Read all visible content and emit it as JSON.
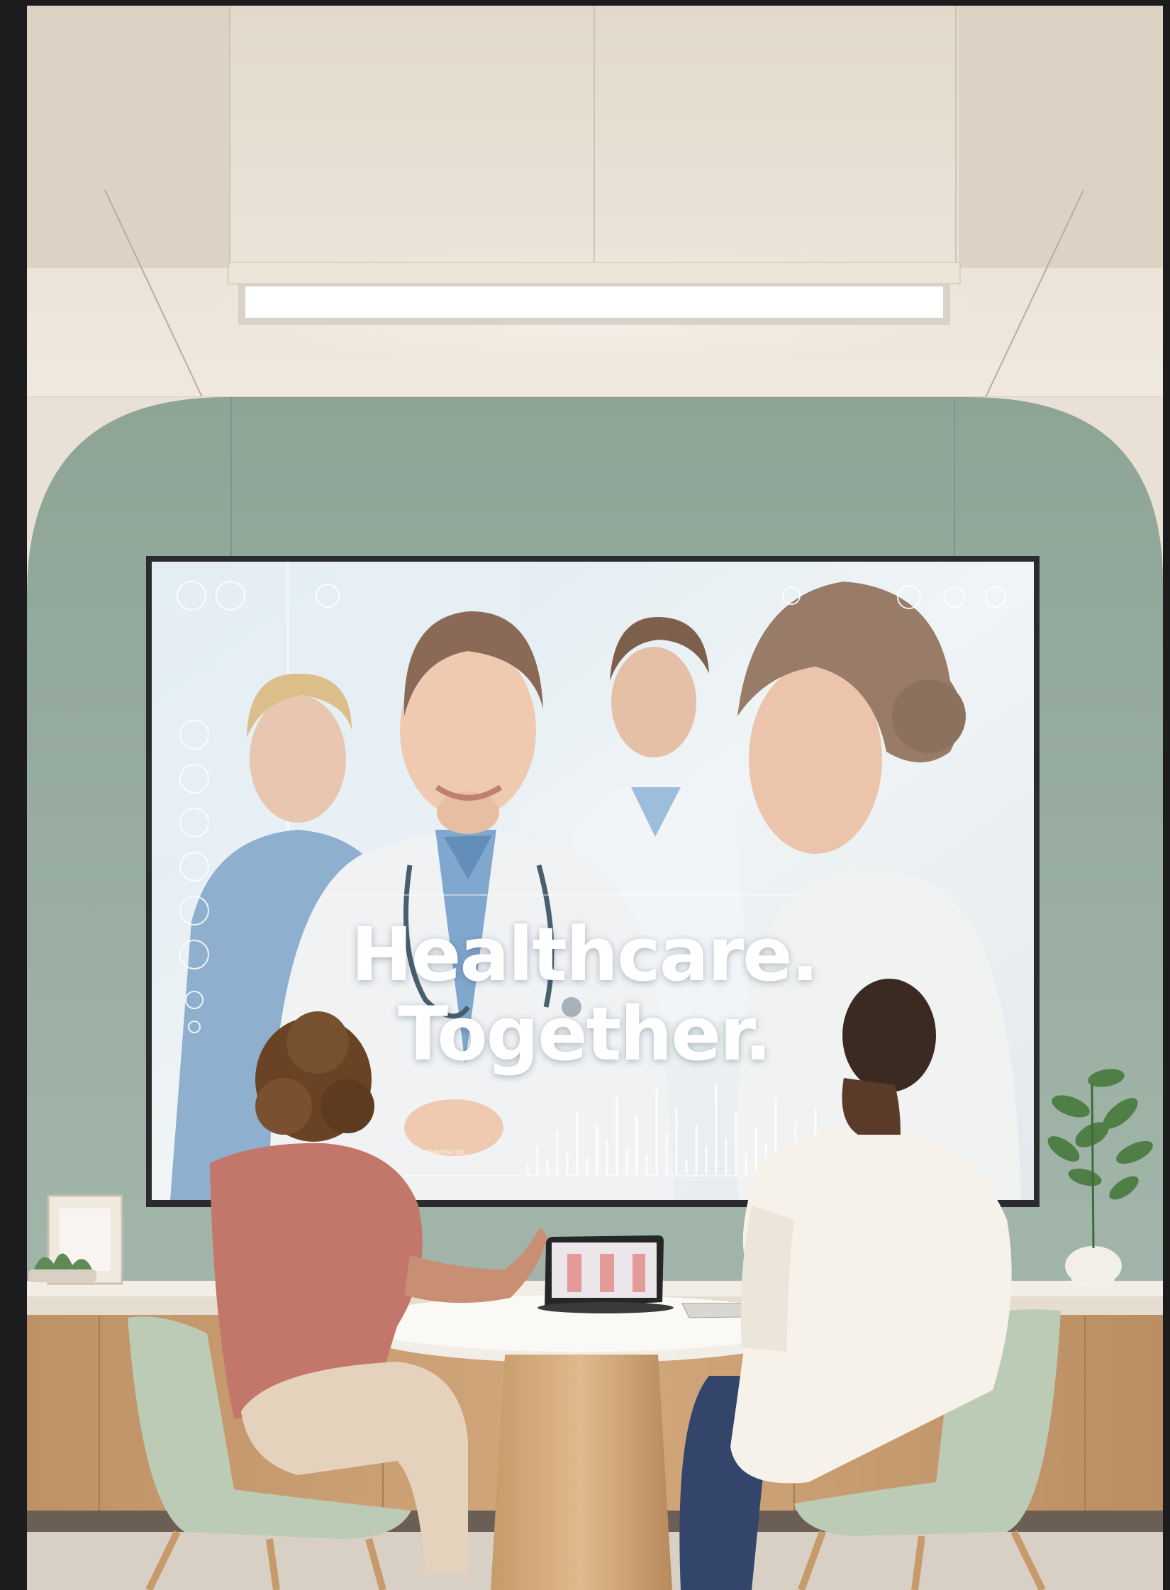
{
  "screen": {
    "headline_line1": "Healthcare.",
    "headline_line2": "Together.",
    "caption": "PRAVENCED…"
  },
  "icons": {
    "top_left": [
      "user-icon",
      "sparkle-icon",
      "person-badge-icon"
    ],
    "top_right": [
      "circle-icon",
      "settings-icon",
      "refresh-icon",
      "help-icon"
    ],
    "left_rail": [
      "message-icon",
      "calendar-icon",
      "document-icon",
      "list-icon",
      "share-icon",
      "edit-icon",
      "phone-icon",
      "more-icon"
    ]
  },
  "colors": {
    "wall": "#97ab9f",
    "ceiling": "#e6ddd0",
    "cabinet_wood": "#c89d70",
    "chair": "#bccbb5",
    "screen_bg": "#e8eff3"
  }
}
